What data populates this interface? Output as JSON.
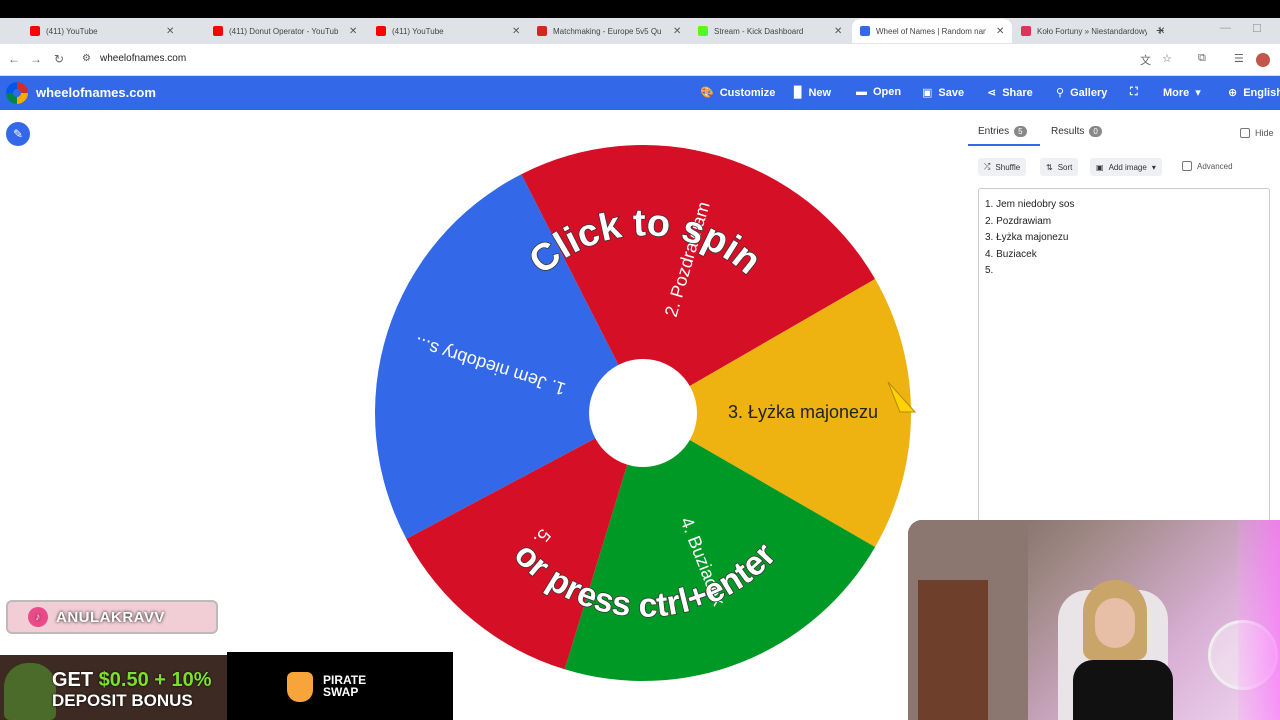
{
  "browser": {
    "tabs": [
      {
        "title": "(411) YouTube",
        "favicon_color": "#ff0000"
      },
      {
        "title": "(411) Donut Operator - YouTub",
        "favicon_color": "#ff0000"
      },
      {
        "title": "(411) YouTube",
        "favicon_color": "#ff0000"
      },
      {
        "title": "Matchmaking - Europe 5v5 Qu",
        "favicon_color": "#d1291f"
      },
      {
        "title": "Stream - Kick Dashboard",
        "favicon_color": "#53fc18"
      },
      {
        "title": "Wheel of Names | Random nan",
        "favicon_color": "#3369e8"
      },
      {
        "title": "Koło Fortuny » Niestandardowy",
        "favicon_color": "#e0325c"
      }
    ],
    "new_tab": "+",
    "url": "wheelofnames.com"
  },
  "app": {
    "brand": "wheelofnames.com",
    "accent_color": "#3369e8",
    "menu": [
      {
        "label": "Customize",
        "icon": "palette-icon",
        "glyph": "🎨"
      },
      {
        "label": "New",
        "icon": "file-icon",
        "glyph": "▉"
      },
      {
        "label": "Open",
        "icon": "folder-icon",
        "glyph": "▬"
      },
      {
        "label": "Save",
        "icon": "save-icon",
        "glyph": "▣"
      },
      {
        "label": "Share",
        "icon": "share-icon",
        "glyph": "⋖"
      },
      {
        "label": "Gallery",
        "icon": "search-icon",
        "glyph": "⚲"
      },
      {
        "label": "",
        "icon": "fullscreen-icon",
        "glyph": "⛶"
      },
      {
        "label": "More",
        "icon": "chevron-down-icon",
        "glyph": "▾"
      },
      {
        "label": "English",
        "icon": "globe-icon",
        "glyph": "⊕"
      }
    ]
  },
  "wheel": {
    "center_text_top": "Click to spin",
    "center_text_bottom": "or press ctrl+enter",
    "segments": [
      {
        "label": "1. Jem niedobry s...",
        "color": "#3369e8"
      },
      {
        "label": "2. Pozdrawiam",
        "color": "#d50f25"
      },
      {
        "label": "3. Łyżka majonezu",
        "color": "#eeb211"
      },
      {
        "label": "4. Buziacek",
        "color": "#009925"
      },
      {
        "label": "5.",
        "color": "#d50f25"
      }
    ]
  },
  "panel": {
    "entries_tab": "Entries",
    "entries_count": "5",
    "results_tab": "Results",
    "results_count": "0",
    "hide_label": "Hide",
    "shuffle": "Shuffle",
    "sort": "Sort",
    "add_image": "Add image",
    "advanced": "Advanced",
    "entries": [
      "1. Jem niedobry sos",
      "2. Pozdrawiam",
      "3. Łyżka majonezu",
      "4. Buziacek",
      "5."
    ]
  },
  "overlay": {
    "social_handle": "ANULAKRAVV",
    "ad_line1_white": "GET ",
    "ad_line1_green": "$0.50 + 10%",
    "ad_line2": "DEPOSIT BONUS",
    "ad_brand_line1": "PIRATE",
    "ad_brand_line2": "SWAP"
  }
}
